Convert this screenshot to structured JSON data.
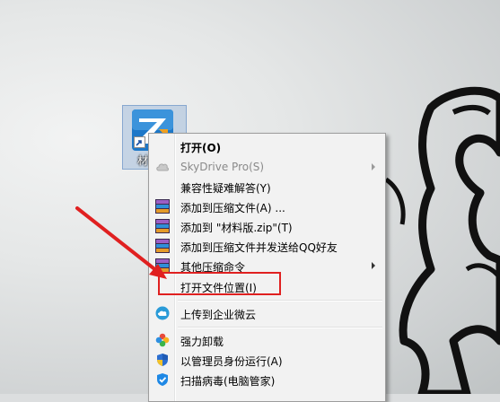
{
  "desktop": {
    "icon_caption": "材",
    "icon_logo": "app-logo-icon"
  },
  "context_menu": {
    "items": [
      {
        "label": "打开(O)",
        "icon": "",
        "bold": true
      },
      {
        "label": "SkyDrive Pro(S)",
        "icon": "cloud-icon",
        "disabled": true,
        "submenu": true
      },
      {
        "label": "兼容性疑难解答(Y)",
        "icon": ""
      },
      {
        "label": "添加到压缩文件(A) ...",
        "icon": "winrar-icon"
      },
      {
        "label": "添加到 \"材料版.zip\"(T)",
        "icon": "winrar-icon"
      },
      {
        "label": "添加到压缩文件并发送给QQ好友",
        "icon": "winrar-icon"
      },
      {
        "label": "其他压缩命令",
        "icon": "winrar-icon",
        "submenu": true
      },
      {
        "label": "打开文件位置(I)",
        "icon": "",
        "highlighted": true
      },
      {
        "label": "上传到企业微云",
        "icon": "weiyun-icon"
      },
      {
        "label": "强力卸载",
        "icon": "uninstall-icon"
      },
      {
        "label": "以管理员身份运行(A)",
        "icon": "shield-icon"
      },
      {
        "label": "扫描病毒(电脑管家)",
        "icon": "scan-shield-icon"
      }
    ]
  },
  "annotation": {
    "arrow_color": "#e02020",
    "box_color": "#e02020"
  }
}
